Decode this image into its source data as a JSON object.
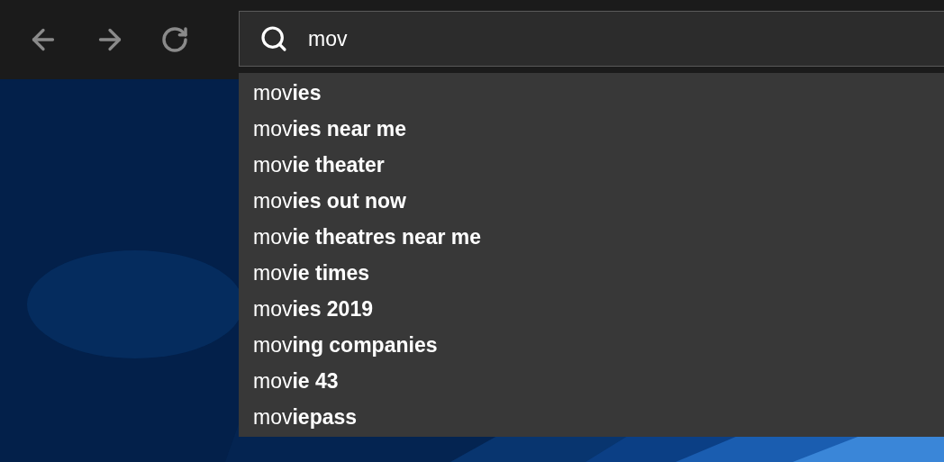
{
  "search": {
    "value": "mov"
  },
  "suggestions": [
    {
      "text": "mov**ies**"
    },
    {
      "text": "mov**ies near me**"
    },
    {
      "text": "mov**ie theater**"
    },
    {
      "text": "mov**ies out now**"
    },
    {
      "text": "mov**ie theatres near me**"
    },
    {
      "text": "mov**ie times**"
    },
    {
      "text": "mov**ies 2019**"
    },
    {
      "text": "mov**ing companies**"
    },
    {
      "text": "mov**ie 43**"
    },
    {
      "text": "mov**iepass**"
    }
  ]
}
